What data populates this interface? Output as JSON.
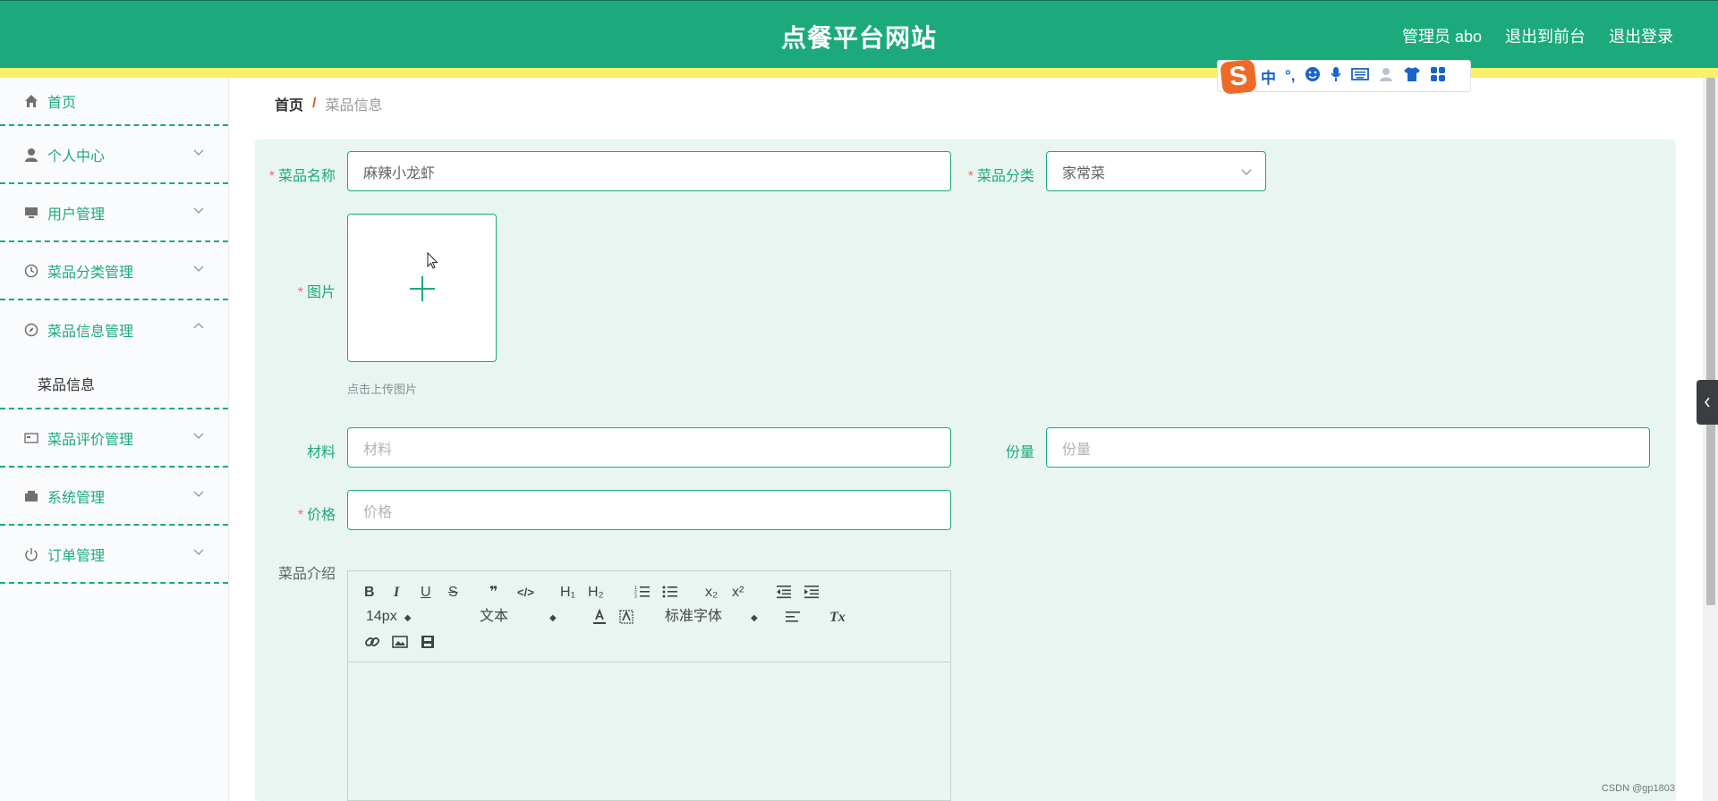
{
  "header": {
    "title": "点餐平台网站",
    "admin": "管理员 abo",
    "to_front": "退出到前台",
    "logout": "退出登录"
  },
  "sidebar": {
    "items": [
      {
        "label": "首页"
      },
      {
        "label": "个人中心"
      },
      {
        "label": "用户管理"
      },
      {
        "label": "菜品分类管理"
      },
      {
        "label": "菜品信息管理",
        "sub": "菜品信息"
      },
      {
        "label": "菜品评价管理"
      },
      {
        "label": "系统管理"
      },
      {
        "label": "订单管理"
      }
    ]
  },
  "breadcrumb": {
    "home": "首页",
    "sep": "/",
    "current": "菜品信息"
  },
  "form": {
    "name_label": "菜品名称",
    "name_value": "麻辣小龙虾",
    "category_label": "菜品分类",
    "category_value": "家常菜",
    "image_label": "图片",
    "upload_tip": "点击上传图片",
    "material_label": "材料",
    "material_placeholder": "材料",
    "portion_label": "份量",
    "portion_placeholder": "份量",
    "price_label": "价格",
    "price_placeholder": "价格",
    "intro_label": "菜品介绍",
    "required_mark": "*"
  },
  "editor": {
    "bold": "B",
    "italic": "I",
    "underline": "U",
    "strike": "S",
    "quote": "❞",
    "code": "</>",
    "h1": "H₁",
    "h2": "H₂",
    "sub": "x₂",
    "sup": "x²",
    "size": "14px",
    "text_type": "文本",
    "font": "标准字体",
    "clear": "Tx"
  },
  "ime": {
    "logo": "S",
    "lang": "中",
    "punct": "°,"
  },
  "watermark": "CSDN @gp1803"
}
